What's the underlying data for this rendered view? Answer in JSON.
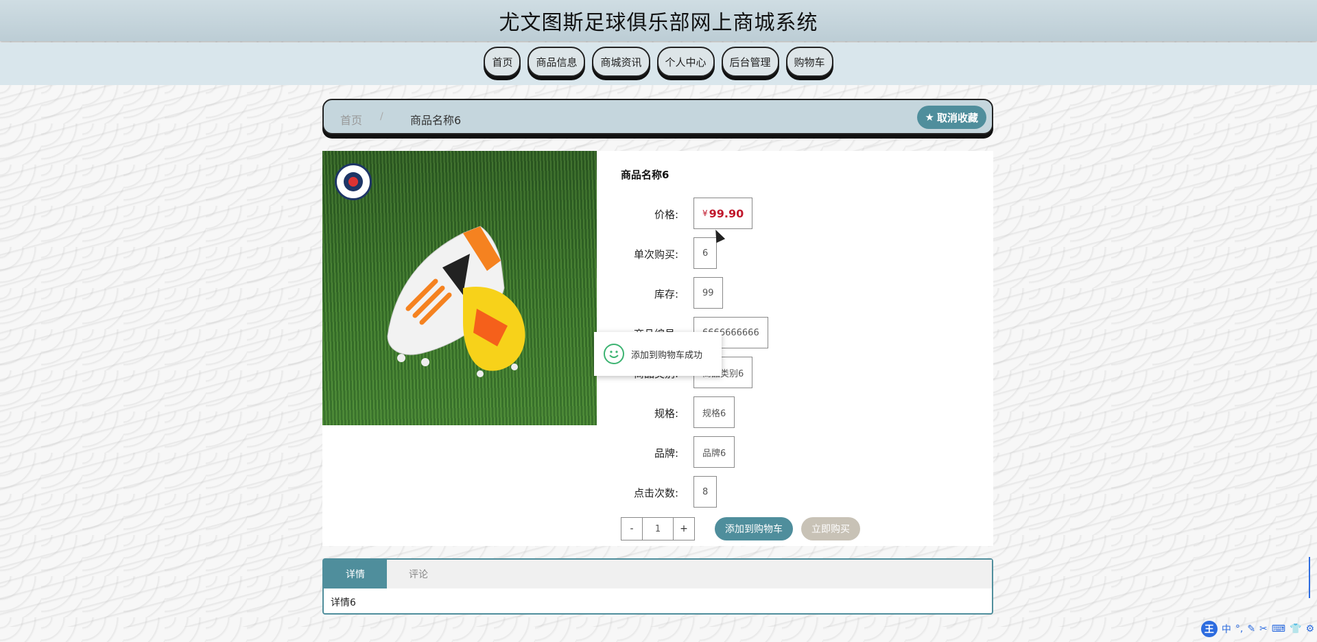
{
  "header": {
    "site_title": "尤文图斯足球俱乐部网上商城系统"
  },
  "nav": {
    "items": [
      {
        "label": "首页"
      },
      {
        "label": "商品信息"
      },
      {
        "label": "商城资讯"
      },
      {
        "label": "个人中心"
      },
      {
        "label": "后台管理"
      },
      {
        "label": "购物车"
      }
    ]
  },
  "breadcrumb": {
    "home": "首页",
    "separator": "/",
    "current": "商品名称6"
  },
  "favorite": {
    "label": "取消收藏",
    "icon": "star-icon"
  },
  "product": {
    "name": "商品名称6",
    "image_icon": "soccer-boot-photo",
    "fields": [
      {
        "label": "价格:",
        "value": "99.90",
        "currency": "¥"
      },
      {
        "label": "单次购买:",
        "value": "6"
      },
      {
        "label": "库存:",
        "value": "99"
      },
      {
        "label": "商品编号:",
        "value": "6666666666"
      },
      {
        "label": "商品类别:",
        "value": "商品类别6"
      },
      {
        "label": "规格:",
        "value": "规格6"
      },
      {
        "label": "品牌:",
        "value": "品牌6"
      },
      {
        "label": "点击次数:",
        "value": "8"
      }
    ]
  },
  "quantity": {
    "minus": "-",
    "value": "1",
    "plus": "+"
  },
  "actions": {
    "add_to_cart": "添加到购物车",
    "buy_now": "立即购买"
  },
  "toast": {
    "message": "添加到购物车成功",
    "icon": "smile-icon"
  },
  "tabs": {
    "items": [
      {
        "label": "详情"
      },
      {
        "label": "评论"
      }
    ],
    "content": "详情6"
  },
  "colors": {
    "accent": "#4f8e9c",
    "price": "#c0182c",
    "header_bg": "#c5d6dd"
  },
  "system_tray": {
    "ime": "王",
    "mode": "中"
  }
}
